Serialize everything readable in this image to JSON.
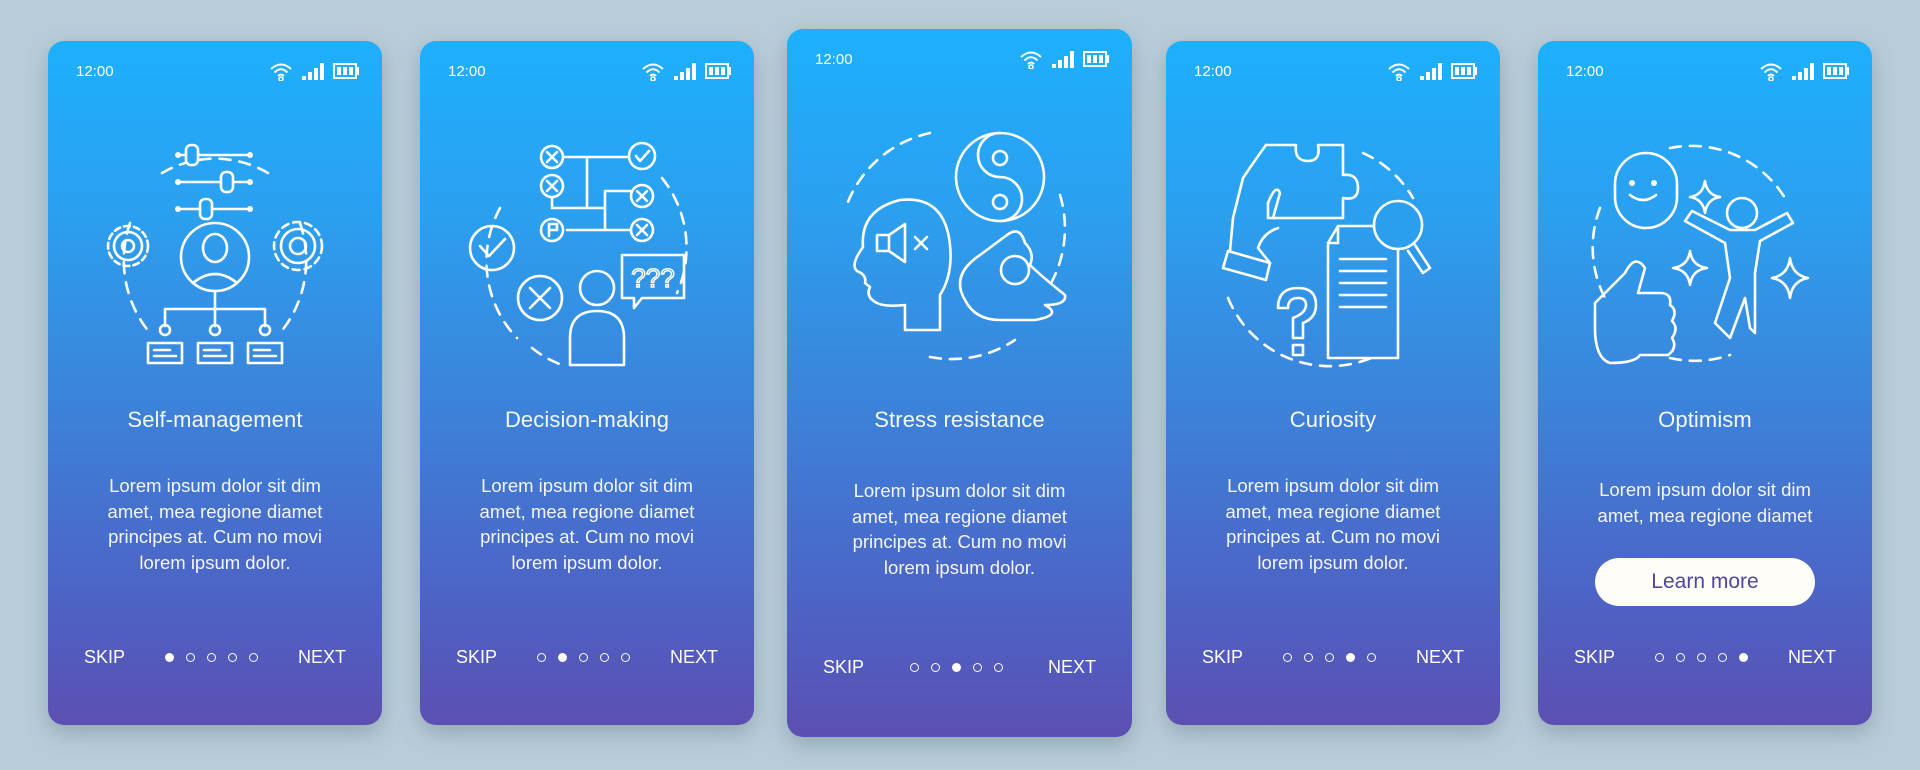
{
  "theme": {
    "background": "#b9cdd8",
    "gradient_top": "#1db0fd",
    "gradient_bottom": "#5d4fb2",
    "button_text": "#4e479e"
  },
  "status_bar": {
    "time": "12:00",
    "icons": [
      "wifi-icon",
      "signal-icon",
      "battery-icon"
    ]
  },
  "nav": {
    "skip_label": "SKIP",
    "next_label": "NEXT",
    "total_steps": 5
  },
  "screens": [
    {
      "title": "Self-management",
      "illustration": "self-management-illustration",
      "body": [
        "Lorem ipsum dolor sit dim",
        "amet, mea regione diamet",
        "principes at. Cum no movi",
        "lorem ipsum dolor."
      ],
      "active_step": 1
    },
    {
      "title": "Decision-making",
      "illustration": "decision-making-illustration",
      "body": [
        "Lorem ipsum dolor sit dim",
        "amet, mea regione diamet",
        "principes at. Cum no movi",
        "lorem ipsum dolor."
      ],
      "active_step": 2
    },
    {
      "title": "Stress resistance",
      "illustration": "stress-resistance-illustration",
      "body": [
        "Lorem ipsum dolor sit dim",
        "amet, mea regione diamet",
        "principes at. Cum no movi",
        "lorem ipsum dolor."
      ],
      "active_step": 3
    },
    {
      "title": "Curiosity",
      "illustration": "curiosity-illustration",
      "body": [
        "Lorem ipsum dolor sit dim",
        "amet, mea regione diamet",
        "principes at. Cum no movi",
        "lorem ipsum dolor."
      ],
      "active_step": 4
    },
    {
      "title": "Optimism",
      "illustration": "optimism-illustration",
      "body": [
        "Lorem ipsum dolor sit dim",
        "amet, mea regione diamet"
      ],
      "active_step": 5,
      "button_label": "Learn more"
    }
  ]
}
